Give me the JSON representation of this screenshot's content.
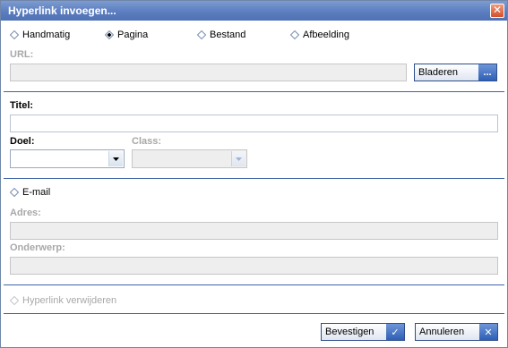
{
  "dialog": {
    "title": "Hyperlink invoegen...",
    "close_glyph": "✕"
  },
  "link_type": {
    "options": [
      {
        "label": "Handmatig",
        "selected": false
      },
      {
        "label": "Pagina",
        "selected": true
      },
      {
        "label": "Bestand",
        "selected": false
      },
      {
        "label": "Afbeelding",
        "selected": false
      }
    ]
  },
  "url": {
    "label": "URL:",
    "value": "",
    "browse_label": "Bladeren",
    "browse_icon": "..."
  },
  "titel": {
    "label": "Titel:",
    "value": ""
  },
  "doel": {
    "label": "Doel:",
    "value": ""
  },
  "class": {
    "label": "Class:",
    "value": ""
  },
  "email": {
    "radio_label": "E-mail",
    "adres_label": "Adres:",
    "adres_value": "",
    "onderwerp_label": "Onderwerp:",
    "onderwerp_value": ""
  },
  "remove": {
    "label": "Hyperlink verwijderen"
  },
  "footer": {
    "confirm_label": "Bevestigen",
    "confirm_icon": "✓",
    "cancel_label": "Annuleren",
    "cancel_icon": "✕"
  },
  "colors": {
    "titlebar": "#5c7ec0",
    "separator": "#3f64a8",
    "disabled_text": "#a8a8a8",
    "close_button": "#d4502c"
  }
}
